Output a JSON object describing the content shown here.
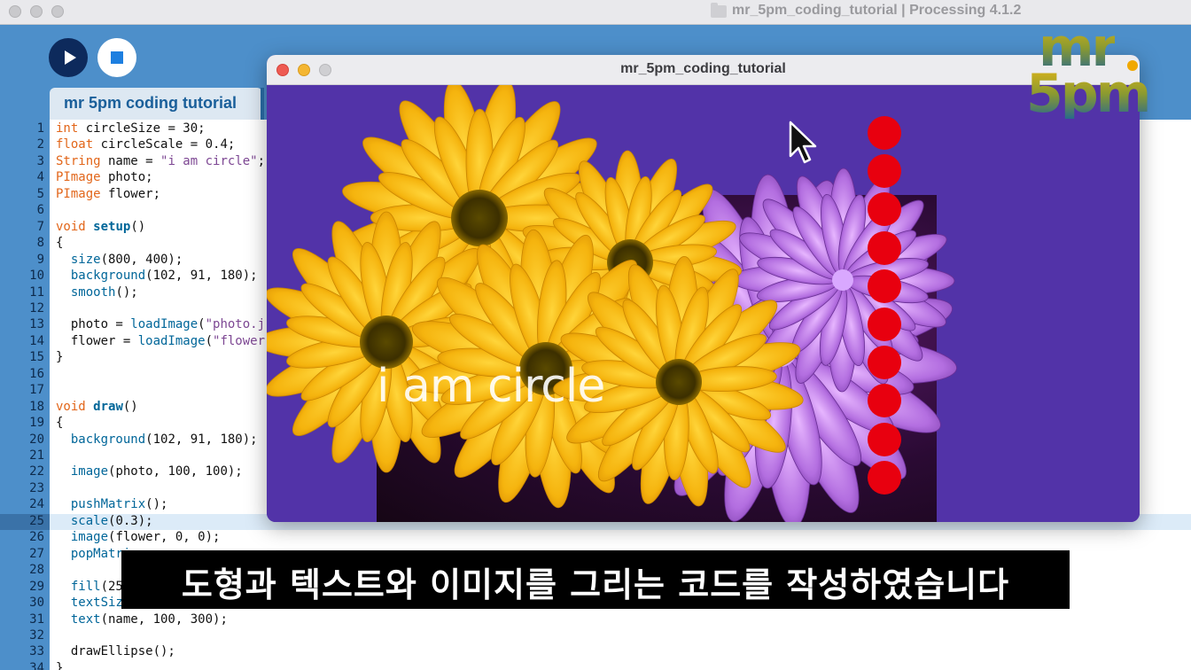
{
  "window": {
    "title": "mr_5pm_coding_tutorial | Processing 4.1.2"
  },
  "toolbar": {
    "run_label": "Run",
    "stop_label": "Stop"
  },
  "tab": {
    "label": "mr 5pm coding tutorial"
  },
  "editor": {
    "current_line": 25,
    "lines": [
      {
        "n": "1",
        "code": "int circleSize = 30;"
      },
      {
        "n": "2",
        "code": "float circleScale = 0.4;"
      },
      {
        "n": "3",
        "code": "String name = \"i am circle\";"
      },
      {
        "n": "4",
        "code": "PImage photo;"
      },
      {
        "n": "5",
        "code": "PImage flower;"
      },
      {
        "n": "6",
        "code": ""
      },
      {
        "n": "7",
        "code": "void setup()"
      },
      {
        "n": "8",
        "code": "{"
      },
      {
        "n": "9",
        "code": "  size(800, 400);"
      },
      {
        "n": "10",
        "code": "  background(102, 91, 180);"
      },
      {
        "n": "11",
        "code": "  smooth();"
      },
      {
        "n": "12",
        "code": ""
      },
      {
        "n": "13",
        "code": "  photo = loadImage(\"photo.j"
      },
      {
        "n": "14",
        "code": "  flower = loadImage(\"flower"
      },
      {
        "n": "15",
        "code": "}"
      },
      {
        "n": "16",
        "code": ""
      },
      {
        "n": "17",
        "code": ""
      },
      {
        "n": "18",
        "code": "void draw()"
      },
      {
        "n": "19",
        "code": "{"
      },
      {
        "n": "20",
        "code": "  background(102, 91, 180);"
      },
      {
        "n": "21",
        "code": ""
      },
      {
        "n": "22",
        "code": "  image(photo, 100, 100);"
      },
      {
        "n": "23",
        "code": ""
      },
      {
        "n": "24",
        "code": "  pushMatrix();"
      },
      {
        "n": "25",
        "code": "  scale(0.3);"
      },
      {
        "n": "26",
        "code": "  image(flower, 0, 0);"
      },
      {
        "n": "27",
        "code": "  popMatri"
      },
      {
        "n": "28",
        "code": ""
      },
      {
        "n": "29",
        "code": "  fill(25"
      },
      {
        "n": "30",
        "code": "  textSiz"
      },
      {
        "n": "31",
        "code": "  text(name, 100, 300);"
      },
      {
        "n": "32",
        "code": ""
      },
      {
        "n": "33",
        "code": "  drawEllipse();"
      },
      {
        "n": "34",
        "code": "}"
      }
    ]
  },
  "sketch": {
    "title": "mr_5pm_coding_tutorial",
    "canvas_text": "i am circle",
    "background_color": "#5233a8",
    "circle_color": "#e8000f",
    "circle_count": 10
  },
  "logo": {
    "line1": "mr",
    "line2": "5pm"
  },
  "subtitle": {
    "text": "도형과 텍스트와 이미지를 그리는 코드를 작성하였습니다"
  },
  "colors": {
    "ide_blue": "#4d8fca",
    "run_button": "#0d2a5c",
    "tab_text": "#1a5f9a"
  }
}
